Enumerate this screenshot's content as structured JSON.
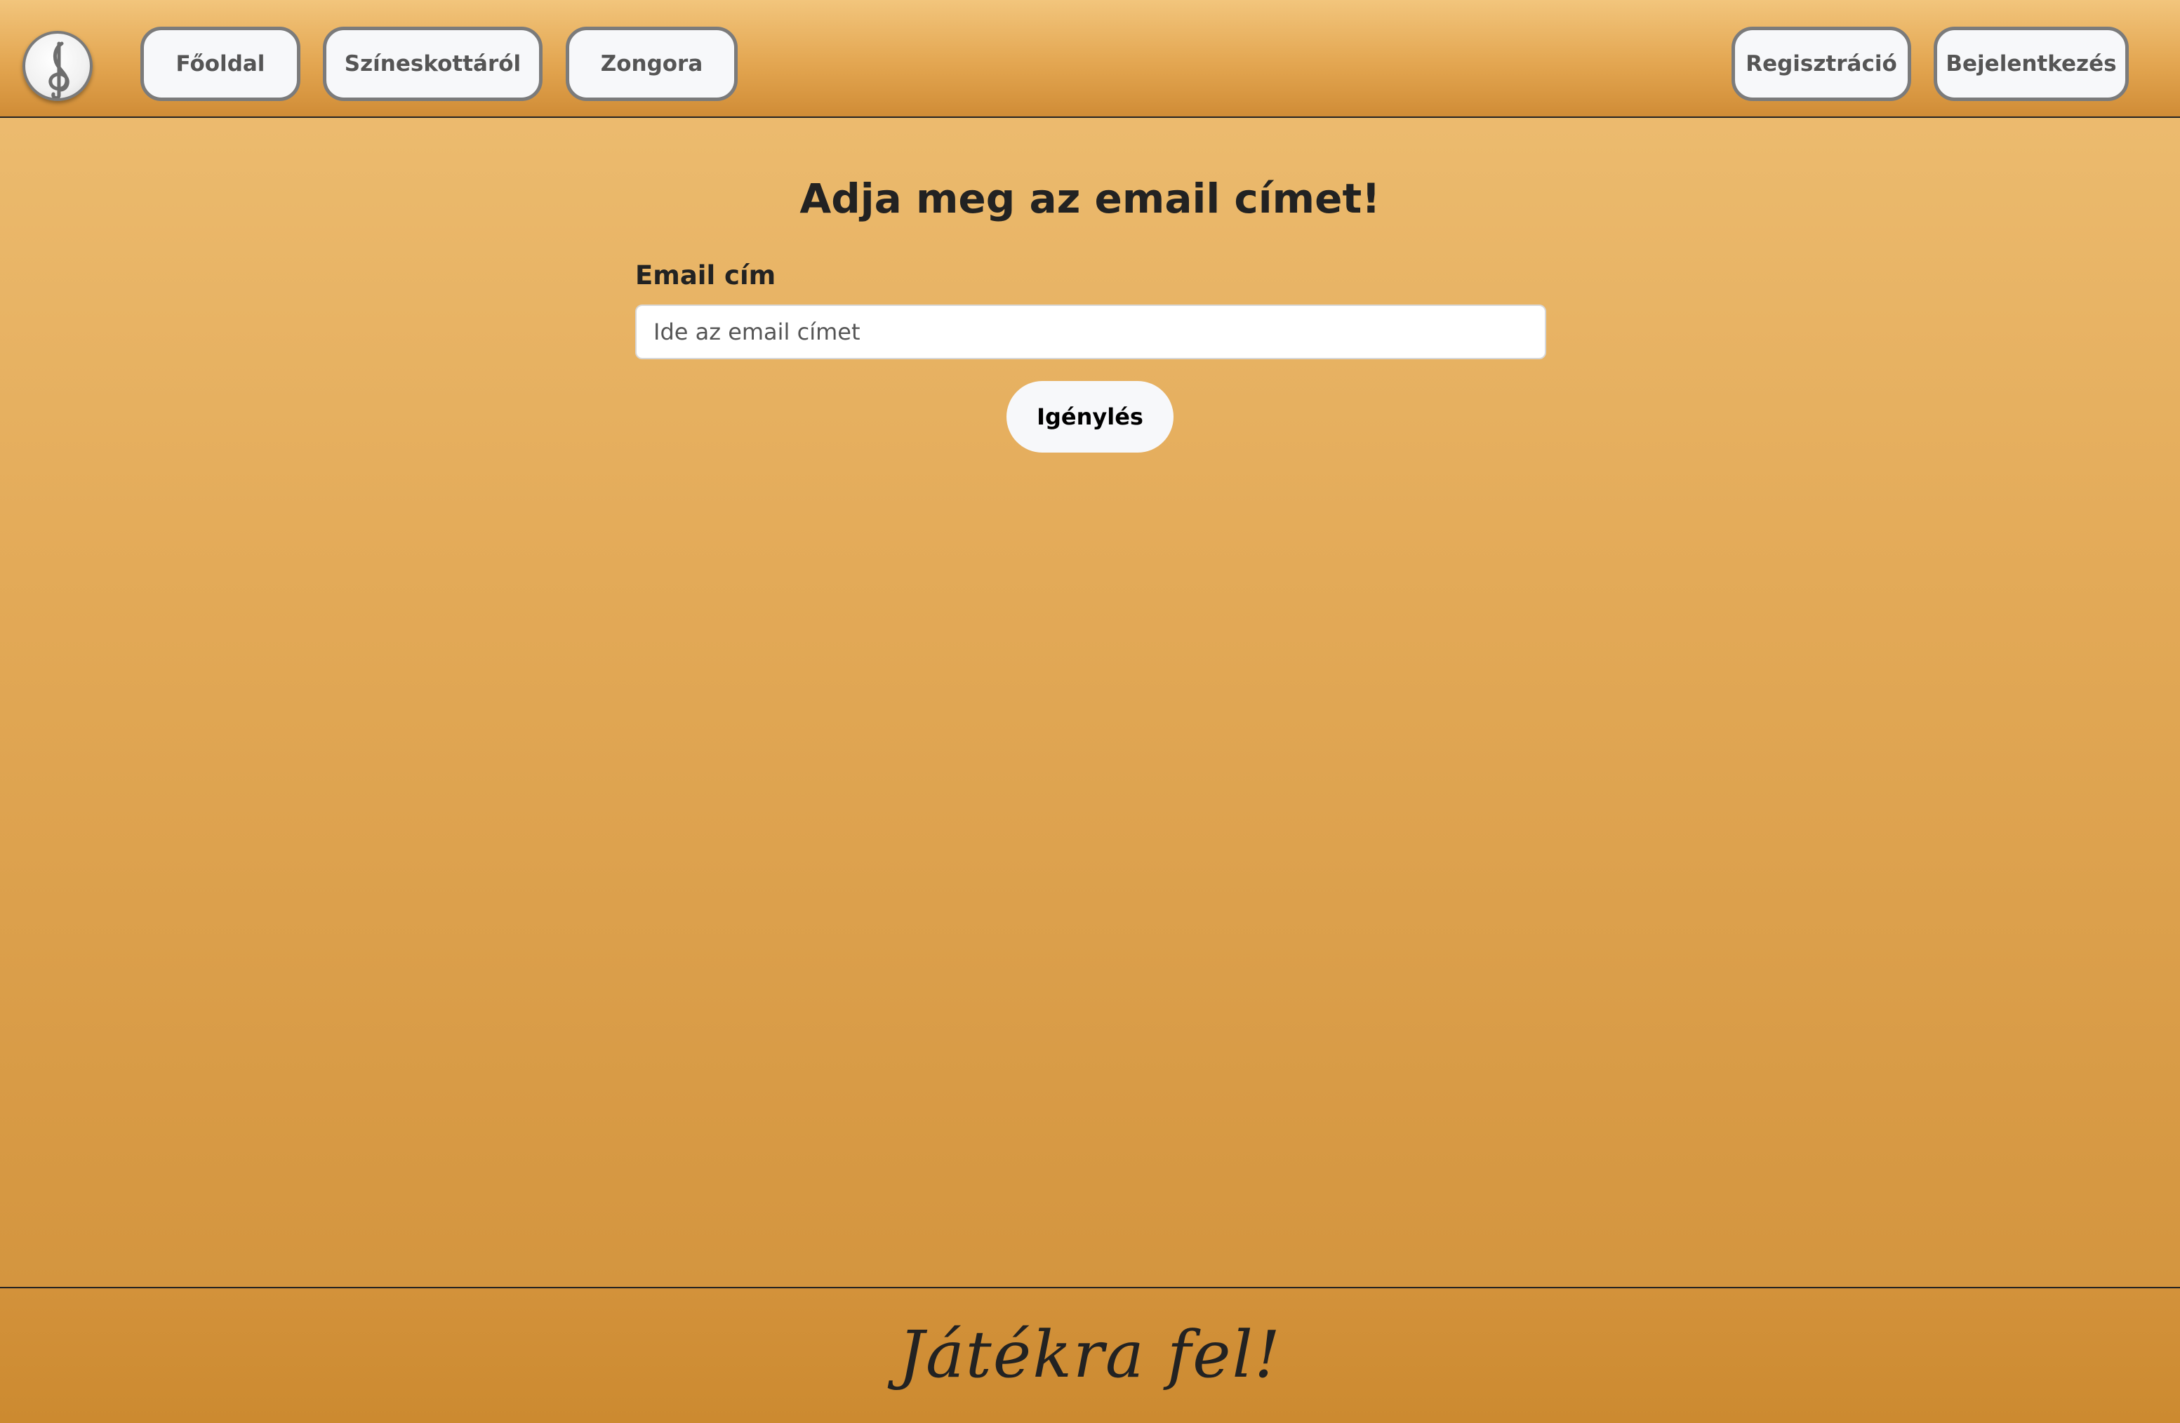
{
  "header": {
    "nav": {
      "home_label": "Főoldal",
      "about_label": "Színeskottáról",
      "piano_label": "Zongora"
    },
    "auth": {
      "register_label": "Regisztráció",
      "login_label": "Bejelentkezés"
    },
    "logo_icon": "treble-clef-icon"
  },
  "main": {
    "title": "Adja meg az email címet!",
    "email_label": "Email cím",
    "email_value": "",
    "email_placeholder": "Ide az email címet",
    "submit_label": "Igénylés"
  },
  "footer": {
    "text": "Játékra fel!"
  },
  "colors": {
    "background_top": "#eebf74",
    "background_bottom": "#d1913a",
    "button_bg": "#f7f8fa",
    "button_border": "#7b7b7b",
    "text": "#222222"
  }
}
